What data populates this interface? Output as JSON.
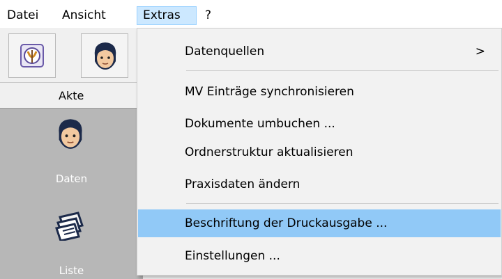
{
  "menubar": {
    "items": [
      {
        "label": "Datei"
      },
      {
        "label": "Ansicht"
      },
      {
        "label": "Extras"
      },
      {
        "label": "?"
      }
    ]
  },
  "toolbar": {
    "buttons": [
      {
        "icon": "shield-caduceus-icon"
      },
      {
        "icon": "person-face-icon"
      }
    ]
  },
  "left_panel": {
    "header": "Akte",
    "nav": [
      {
        "label": "Daten",
        "icon": "person-face-icon"
      },
      {
        "label": "Liste",
        "icon": "document-stack-icon"
      }
    ]
  },
  "extras_menu": {
    "items": [
      {
        "label": "Datenquellen",
        "submenu_arrow": ">"
      },
      {
        "label": "MV Einträge synchronisieren"
      },
      {
        "label": "Dokumente umbuchen ..."
      },
      {
        "label": "Ordnerstruktur aktualisieren"
      },
      {
        "label": "Praxisdaten ändern"
      },
      {
        "label": "Beschriftung der Druckausgabe ..."
      },
      {
        "label": "Einstellungen ..."
      }
    ],
    "highlighted_item": "Beschriftung der Druckausgabe ..."
  },
  "colors": {
    "menu_active_bg": "#cce8ff",
    "menu_hover_bg": "#91c9f7",
    "panel_bg": "#b7b7b7"
  }
}
